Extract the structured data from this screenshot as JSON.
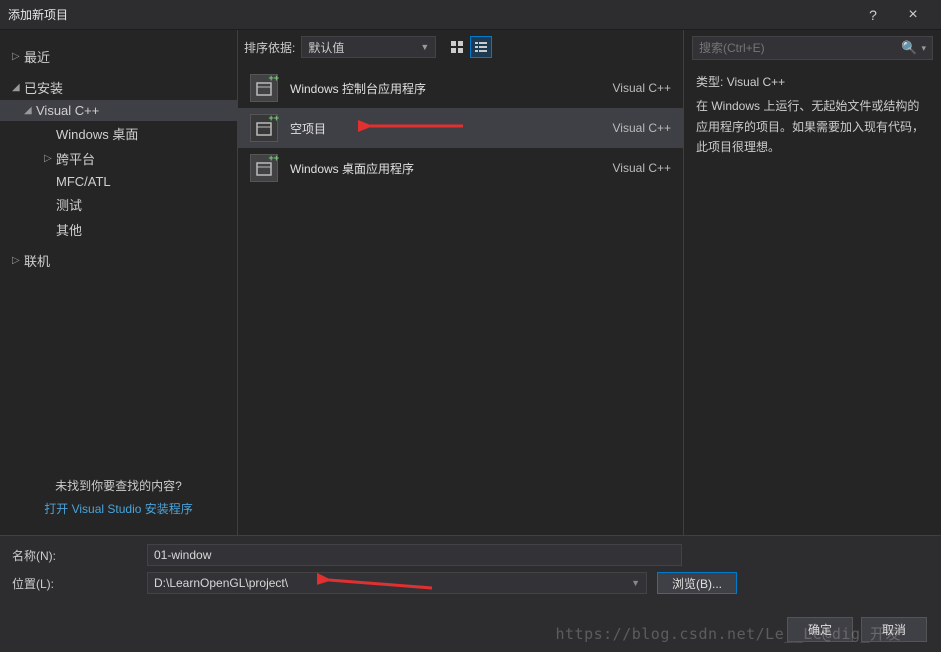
{
  "titlebar": {
    "title": "添加新项目",
    "help": "?",
    "close": "×"
  },
  "sidebar": {
    "items": [
      {
        "label": "最近",
        "arrow": "▷",
        "lvl": 0
      },
      {
        "label": "已安装",
        "arrow": "▢",
        "lvl": 0
      },
      {
        "label": "Visual C++",
        "arrow": "▢",
        "lvl": 1,
        "selected": true
      },
      {
        "label": "Windows 桌面",
        "arrow": "",
        "lvl": 2
      },
      {
        "label": "跨平台",
        "arrow": "▷",
        "lvl": 2
      },
      {
        "label": "MFC/ATL",
        "arrow": "",
        "lvl": 2
      },
      {
        "label": "测试",
        "arrow": "",
        "lvl": 2
      },
      {
        "label": "其他",
        "arrow": "",
        "lvl": 2
      },
      {
        "label": "联机",
        "arrow": "▷",
        "lvl": 0
      }
    ],
    "footer_q": "未找到你要查找的内容?",
    "footer_link": "打开 Visual Studio 安装程序"
  },
  "toolbar": {
    "sort_label": "排序依据:",
    "sort_value": "默认值"
  },
  "templates": [
    {
      "name": "Windows 控制台应用程序",
      "lang": "Visual C++"
    },
    {
      "name": "空项目",
      "lang": "Visual C++",
      "selected": true
    },
    {
      "name": "Windows 桌面应用程序",
      "lang": "Visual C++"
    }
  ],
  "rightpane": {
    "search_placeholder": "搜索(Ctrl+E)",
    "type_label": "类型:",
    "type_value": "Visual C++",
    "desc": "在 Windows 上运行、无起始文件或结构的应用程序的项目。如果需要加入现有代码，此项目很理想。"
  },
  "form": {
    "name_label": "名称(N):",
    "name_value": "01-window",
    "loc_label": "位置(L):",
    "loc_value": "D:\\LearnOpenGL\\project\\",
    "browse": "浏览(B)..."
  },
  "footer": {
    "ok": "确定",
    "cancel": "取消"
  },
  "watermark": "https://blog.csdn.net/Le__Le@dig_开发"
}
